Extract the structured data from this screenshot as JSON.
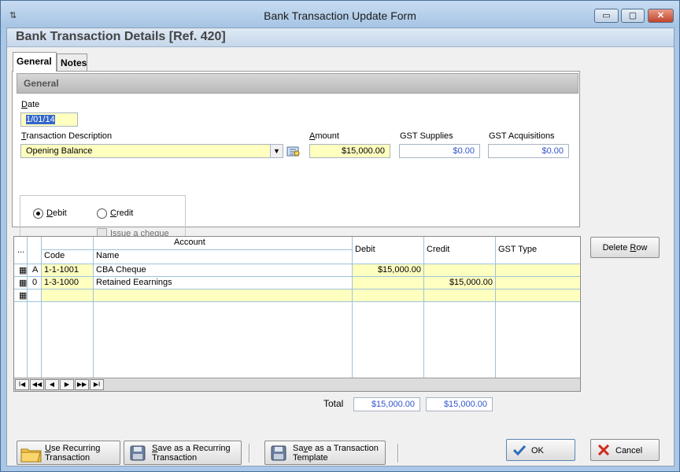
{
  "window": {
    "title": "Bank Transaction Update Form",
    "min": "▭",
    "max": "▢",
    "close": "✕",
    "app_icon": "⇅"
  },
  "header": {
    "title": "Bank Transaction Details [Ref. 420]"
  },
  "tabs": [
    {
      "label": "General"
    },
    {
      "label": "Notes"
    }
  ],
  "general": {
    "group_title": "General",
    "date_label": "Date",
    "date_value": "1/01/14",
    "desc_label": "Transaction Description",
    "desc_value": "Opening Balance",
    "amount_label": "Amount",
    "amount_value": "$15,000.00",
    "gst_supplies_label": "GST Supplies",
    "gst_supplies_value": "$0.00",
    "gst_acq_label": "GST Acquisitions",
    "gst_acq_value": "$0.00",
    "debit_label": "Debit",
    "credit_label": "Credit",
    "issue_cheque_label": "Issue a cheque",
    "selected": "Debit"
  },
  "grid": {
    "selector_header": "...",
    "account_header": "Account",
    "code_header": "Code",
    "name_header": "Name",
    "debit_header": "Debit",
    "credit_header": "Credit",
    "gst_header": "GST Type",
    "rows": [
      {
        "flag": "A",
        "code": "1-1-1001",
        "name": "CBA Cheque",
        "debit": "$15,000.00",
        "credit": "",
        "gst": ""
      },
      {
        "flag": "0",
        "code": "1-3-1000",
        "name": "Retained Eearnings",
        "debit": "",
        "credit": "$15,000.00",
        "gst": ""
      },
      {
        "flag": "",
        "code": "",
        "name": "",
        "debit": "",
        "credit": "",
        "gst": ""
      }
    ],
    "nav": [
      "I◀",
      "◀◀",
      "◀",
      "▶",
      "▶▶",
      "▶I"
    ]
  },
  "delete_row_label": "Delete Row",
  "totals": {
    "label": "Total",
    "debit": "$15,000.00",
    "credit": "$15,000.00"
  },
  "footer": {
    "use_recurring": "Use Recurring Transaction",
    "save_recurring": "Save as a Recurring Transaction",
    "save_template": "Save as a Transaction Template",
    "ok": "OK",
    "cancel": "Cancel"
  },
  "colors": {
    "field_yellow": "#ffffc0",
    "blue_text": "#3355cc",
    "grid_lines": "#9ec3d9"
  }
}
